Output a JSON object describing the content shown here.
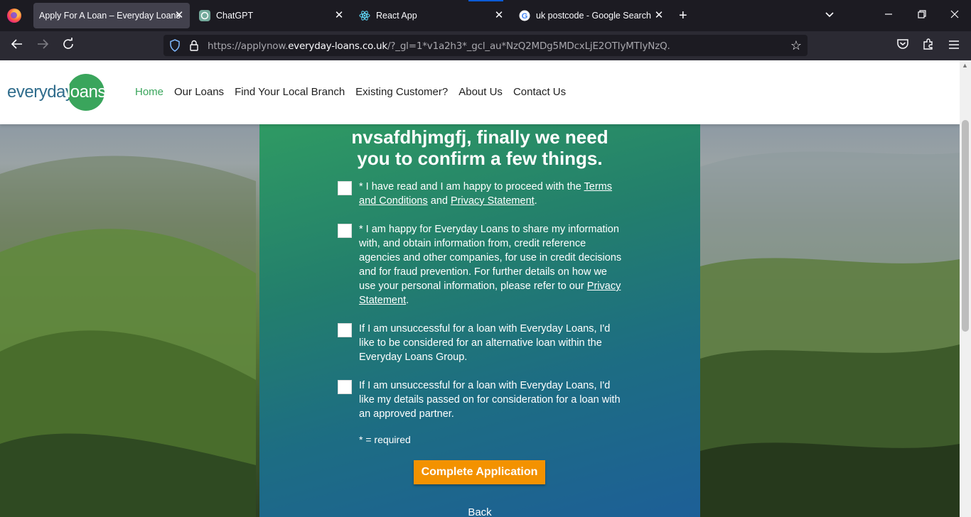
{
  "browser": {
    "tabs": [
      {
        "title": "Apply For A Loan – Everyday Loans",
        "active": true,
        "favicon": "firefox-default-icon"
      },
      {
        "title": "ChatGPT",
        "active": false,
        "favicon": "chatgpt-icon"
      },
      {
        "title": "React App",
        "active": false,
        "favicon": "react-icon"
      },
      {
        "title": "uk postcode - Google Search",
        "active": false,
        "favicon": "google-icon"
      }
    ],
    "new_tab_glyph": "+",
    "url_prefix": "https://applynow.",
    "url_domain": "everyday-loans.co.uk",
    "url_rest": "/?_gl=1*v1a2h3*_gcl_au*NzQ2MDg5MDcxLjE2OTIyMTIyNzQ."
  },
  "site": {
    "logo_left": "everyday",
    "logo_right": "loans",
    "nav": [
      "Home",
      "Our Loans",
      "Find Your Local Branch",
      "Existing Customer?",
      "About Us",
      "Contact Us"
    ],
    "accent_color": "#3aa55c",
    "button_color": "#f39200"
  },
  "form": {
    "heading_line1": "nvsafdhjmgfj, finally we need",
    "heading_line2": "you to confirm a few things.",
    "check1": {
      "pre": "* I have read and I am happy to proceed with the ",
      "link1": "Terms and Conditions",
      "mid": " and ",
      "link2": "Privacy Statement",
      "post": "."
    },
    "check2": {
      "pre": "* I am happy for Everyday Loans to share my information with, and obtain information from, credit reference agencies and other companies, for use in credit decisions and for fraud prevention. For further details on how we use your personal information, please refer to our ",
      "link": "Privacy Statement",
      "post": "."
    },
    "check3": "If I am unsuccessful for a loan with Everyday Loans, I'd like to be considered for an alternative loan within the Everyday Loans Group.",
    "check4": "If I am unsuccessful for a loan with Everyday Loans, I'd like my details passed on for consideration for a loan with an approved partner.",
    "required_note": "* = required",
    "submit_label": "Complete Application",
    "back_label": "Back"
  }
}
